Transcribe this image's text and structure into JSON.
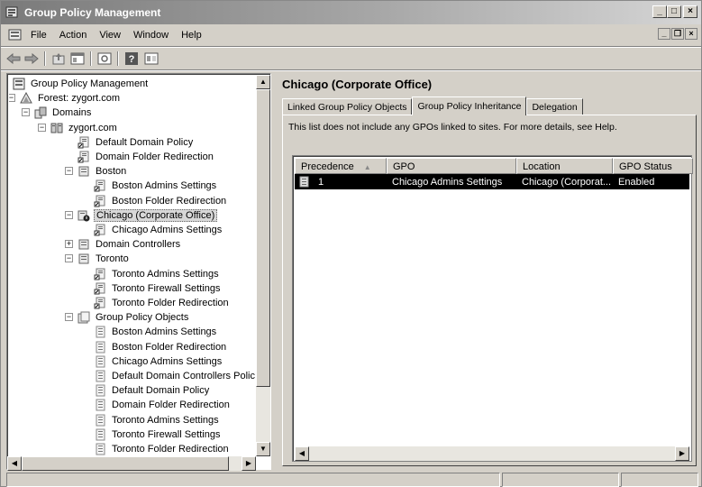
{
  "window": {
    "title": "Group Policy Management"
  },
  "menu": {
    "items": [
      "File",
      "Action",
      "View",
      "Window",
      "Help"
    ]
  },
  "toolbar": {
    "icons": [
      "back-icon",
      "forward-icon",
      "up-folder-icon",
      "show-hide-tree-icon",
      "refresh-icon",
      "help-icon",
      "properties-icon"
    ]
  },
  "tree": {
    "items": [
      {
        "label": "Group Policy Management",
        "icon": "gpm-console-icon"
      },
      {
        "label": "Forest: zygort.com",
        "icon": "forest-icon"
      },
      {
        "label": "Domains",
        "icon": "domains-icon"
      },
      {
        "label": "zygort.com",
        "icon": "domain-icon"
      },
      {
        "label": "Default Domain Policy",
        "icon": "gpo-link-icon"
      },
      {
        "label": "Domain Folder Redirection",
        "icon": "gpo-link-icon"
      },
      {
        "label": "Boston",
        "icon": "ou-icon"
      },
      {
        "label": "Boston Admins Settings",
        "icon": "gpo-link-icon"
      },
      {
        "label": "Boston Folder Redirection",
        "icon": "gpo-link-icon"
      },
      {
        "label": "Chicago (Corporate Office)",
        "icon": "ou-blocked-icon"
      },
      {
        "label": "Chicago Admins Settings",
        "icon": "gpo-link-icon"
      },
      {
        "label": "Domain Controllers",
        "icon": "ou-icon"
      },
      {
        "label": "Toronto",
        "icon": "ou-icon"
      },
      {
        "label": "Toronto Admins Settings",
        "icon": "gpo-link-icon"
      },
      {
        "label": "Toronto Firewall Settings",
        "icon": "gpo-link-icon"
      },
      {
        "label": "Toronto Folder Redirection",
        "icon": "gpo-link-icon"
      },
      {
        "label": "Group Policy Objects",
        "icon": "gpo-container-icon"
      },
      {
        "label": "Boston Admins Settings",
        "icon": "gpo-icon"
      },
      {
        "label": "Boston Folder Redirection",
        "icon": "gpo-icon"
      },
      {
        "label": "Chicago Admins Settings",
        "icon": "gpo-icon"
      },
      {
        "label": "Default Domain Controllers Polic",
        "icon": "gpo-icon"
      },
      {
        "label": "Default Domain Policy",
        "icon": "gpo-icon"
      },
      {
        "label": "Domain Folder Redirection",
        "icon": "gpo-icon"
      },
      {
        "label": "Toronto Admins Settings",
        "icon": "gpo-icon"
      },
      {
        "label": "Toronto Firewall Settings",
        "icon": "gpo-icon"
      },
      {
        "label": "Toronto Folder Redirection",
        "icon": "gpo-icon"
      }
    ]
  },
  "details": {
    "title": "Chicago (Corporate Office)",
    "tabs": [
      "Linked Group Policy Objects",
      "Group Policy Inheritance",
      "Delegation"
    ],
    "active_tab": "Group Policy Inheritance",
    "info": "This list does not include any GPOs linked to sites. For more details, see Help.",
    "columns": [
      "Precedence",
      "GPO",
      "Location",
      "GPO Status"
    ],
    "sort_indicator": "▲",
    "rows": [
      {
        "precedence": "1",
        "gpo": "Chicago Admins Settings",
        "location": "Chicago (Corporat...",
        "status": "Enabled"
      }
    ]
  }
}
